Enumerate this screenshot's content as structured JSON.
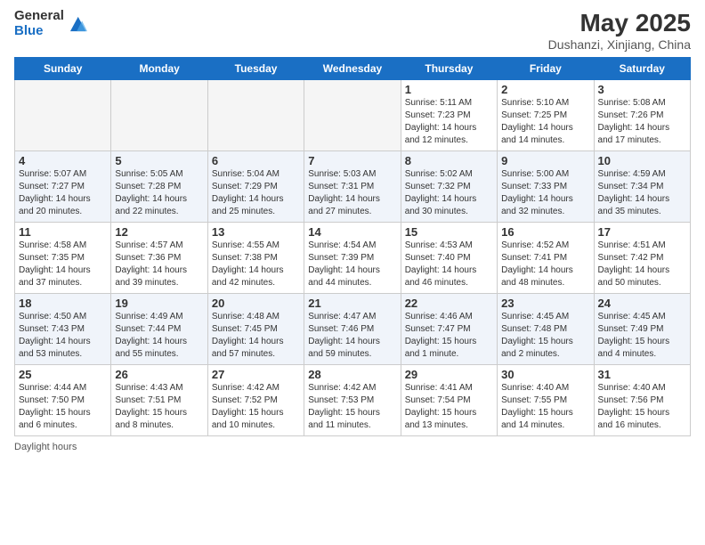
{
  "header": {
    "logo_general": "General",
    "logo_blue": "Blue",
    "title": "May 2025",
    "location": "Dushanzi, Xinjiang, China"
  },
  "days_of_week": [
    "Sunday",
    "Monday",
    "Tuesday",
    "Wednesday",
    "Thursday",
    "Friday",
    "Saturday"
  ],
  "footer": {
    "daylight_hours": "Daylight hours"
  },
  "weeks": [
    [
      {
        "day": "",
        "info": ""
      },
      {
        "day": "",
        "info": ""
      },
      {
        "day": "",
        "info": ""
      },
      {
        "day": "",
        "info": ""
      },
      {
        "day": "1",
        "info": "Sunrise: 5:11 AM\nSunset: 7:23 PM\nDaylight: 14 hours\nand 12 minutes."
      },
      {
        "day": "2",
        "info": "Sunrise: 5:10 AM\nSunset: 7:25 PM\nDaylight: 14 hours\nand 14 minutes."
      },
      {
        "day": "3",
        "info": "Sunrise: 5:08 AM\nSunset: 7:26 PM\nDaylight: 14 hours\nand 17 minutes."
      }
    ],
    [
      {
        "day": "4",
        "info": "Sunrise: 5:07 AM\nSunset: 7:27 PM\nDaylight: 14 hours\nand 20 minutes."
      },
      {
        "day": "5",
        "info": "Sunrise: 5:05 AM\nSunset: 7:28 PM\nDaylight: 14 hours\nand 22 minutes."
      },
      {
        "day": "6",
        "info": "Sunrise: 5:04 AM\nSunset: 7:29 PM\nDaylight: 14 hours\nand 25 minutes."
      },
      {
        "day": "7",
        "info": "Sunrise: 5:03 AM\nSunset: 7:31 PM\nDaylight: 14 hours\nand 27 minutes."
      },
      {
        "day": "8",
        "info": "Sunrise: 5:02 AM\nSunset: 7:32 PM\nDaylight: 14 hours\nand 30 minutes."
      },
      {
        "day": "9",
        "info": "Sunrise: 5:00 AM\nSunset: 7:33 PM\nDaylight: 14 hours\nand 32 minutes."
      },
      {
        "day": "10",
        "info": "Sunrise: 4:59 AM\nSunset: 7:34 PM\nDaylight: 14 hours\nand 35 minutes."
      }
    ],
    [
      {
        "day": "11",
        "info": "Sunrise: 4:58 AM\nSunset: 7:35 PM\nDaylight: 14 hours\nand 37 minutes."
      },
      {
        "day": "12",
        "info": "Sunrise: 4:57 AM\nSunset: 7:36 PM\nDaylight: 14 hours\nand 39 minutes."
      },
      {
        "day": "13",
        "info": "Sunrise: 4:55 AM\nSunset: 7:38 PM\nDaylight: 14 hours\nand 42 minutes."
      },
      {
        "day": "14",
        "info": "Sunrise: 4:54 AM\nSunset: 7:39 PM\nDaylight: 14 hours\nand 44 minutes."
      },
      {
        "day": "15",
        "info": "Sunrise: 4:53 AM\nSunset: 7:40 PM\nDaylight: 14 hours\nand 46 minutes."
      },
      {
        "day": "16",
        "info": "Sunrise: 4:52 AM\nSunset: 7:41 PM\nDaylight: 14 hours\nand 48 minutes."
      },
      {
        "day": "17",
        "info": "Sunrise: 4:51 AM\nSunset: 7:42 PM\nDaylight: 14 hours\nand 50 minutes."
      }
    ],
    [
      {
        "day": "18",
        "info": "Sunrise: 4:50 AM\nSunset: 7:43 PM\nDaylight: 14 hours\nand 53 minutes."
      },
      {
        "day": "19",
        "info": "Sunrise: 4:49 AM\nSunset: 7:44 PM\nDaylight: 14 hours\nand 55 minutes."
      },
      {
        "day": "20",
        "info": "Sunrise: 4:48 AM\nSunset: 7:45 PM\nDaylight: 14 hours\nand 57 minutes."
      },
      {
        "day": "21",
        "info": "Sunrise: 4:47 AM\nSunset: 7:46 PM\nDaylight: 14 hours\nand 59 minutes."
      },
      {
        "day": "22",
        "info": "Sunrise: 4:46 AM\nSunset: 7:47 PM\nDaylight: 15 hours\nand 1 minute."
      },
      {
        "day": "23",
        "info": "Sunrise: 4:45 AM\nSunset: 7:48 PM\nDaylight: 15 hours\nand 2 minutes."
      },
      {
        "day": "24",
        "info": "Sunrise: 4:45 AM\nSunset: 7:49 PM\nDaylight: 15 hours\nand 4 minutes."
      }
    ],
    [
      {
        "day": "25",
        "info": "Sunrise: 4:44 AM\nSunset: 7:50 PM\nDaylight: 15 hours\nand 6 minutes."
      },
      {
        "day": "26",
        "info": "Sunrise: 4:43 AM\nSunset: 7:51 PM\nDaylight: 15 hours\nand 8 minutes."
      },
      {
        "day": "27",
        "info": "Sunrise: 4:42 AM\nSunset: 7:52 PM\nDaylight: 15 hours\nand 10 minutes."
      },
      {
        "day": "28",
        "info": "Sunrise: 4:42 AM\nSunset: 7:53 PM\nDaylight: 15 hours\nand 11 minutes."
      },
      {
        "day": "29",
        "info": "Sunrise: 4:41 AM\nSunset: 7:54 PM\nDaylight: 15 hours\nand 13 minutes."
      },
      {
        "day": "30",
        "info": "Sunrise: 4:40 AM\nSunset: 7:55 PM\nDaylight: 15 hours\nand 14 minutes."
      },
      {
        "day": "31",
        "info": "Sunrise: 4:40 AM\nSunset: 7:56 PM\nDaylight: 15 hours\nand 16 minutes."
      }
    ]
  ]
}
